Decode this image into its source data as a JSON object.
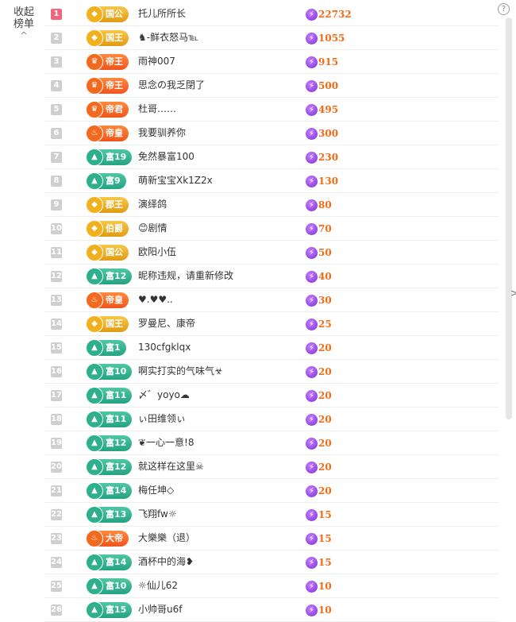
{
  "sidebar": {
    "collapse_label": "收起榜单",
    "collapse_icon": "chevron-up-icon",
    "chevron": "^"
  },
  "help_icon": "?",
  "side_arrow": ">",
  "rows": [
    {
      "rank": "1",
      "badge": "国公",
      "tier": "gold",
      "icon": "crown-icon",
      "glyph": "◆",
      "name": "托儿所所长",
      "score": "22732"
    },
    {
      "rank": "2",
      "badge": "国王",
      "tier": "gold",
      "icon": "crown-icon",
      "glyph": "◆",
      "name": "♞-鲜衣怒马℡",
      "score": "1055"
    },
    {
      "rank": "3",
      "badge": "帝王",
      "tier": "orange",
      "icon": "shield-icon",
      "glyph": "♛",
      "name": "雨神007",
      "score": "915"
    },
    {
      "rank": "4",
      "badge": "帝王",
      "tier": "orange",
      "icon": "shield-icon",
      "glyph": "♛",
      "name": "思念の我乏閉了",
      "score": "500"
    },
    {
      "rank": "5",
      "badge": "帝君",
      "tier": "orange",
      "icon": "shield-icon",
      "glyph": "♛",
      "name": "杜哥……",
      "score": "495"
    },
    {
      "rank": "6",
      "badge": "帝皇",
      "tier": "orange",
      "icon": "dragon-icon",
      "glyph": "♨",
      "name": "我要驯养你",
      "score": "300"
    },
    {
      "rank": "7",
      "badge": "富19",
      "tier": "teal",
      "icon": "mountain-icon",
      "glyph": "▲",
      "name": "免然暴富100",
      "score": "230"
    },
    {
      "rank": "8",
      "badge": "富9",
      "tier": "teal",
      "icon": "mountain-icon",
      "glyph": "▲",
      "name": "萌新宝宝Xk1Z2x",
      "score": "130"
    },
    {
      "rank": "9",
      "badge": "郡王",
      "tier": "gold",
      "icon": "crown-icon",
      "glyph": "◆",
      "name": "演绎鸽",
      "score": "80"
    },
    {
      "rank": "10",
      "badge": "伯爵",
      "tier": "gold",
      "icon": "crown-icon",
      "glyph": "◆",
      "name": "😊剧情",
      "score": "70"
    },
    {
      "rank": "11",
      "badge": "国公",
      "tier": "gold",
      "icon": "crown-icon",
      "glyph": "◆",
      "name": "欧阳小伍",
      "score": "50"
    },
    {
      "rank": "12",
      "badge": "富12",
      "tier": "teal",
      "icon": "mountain-icon",
      "glyph": "▲",
      "name": "昵称违规，请重新修改",
      "score": "40"
    },
    {
      "rank": "13",
      "badge": "帝皇",
      "tier": "orange",
      "icon": "dragon-icon",
      "glyph": "♨",
      "name": "♥.♥♥..",
      "score": "30"
    },
    {
      "rank": "14",
      "badge": "国王",
      "tier": "gold",
      "icon": "crown-icon",
      "glyph": "◆",
      "name": "罗曼尼、康帝",
      "score": "25"
    },
    {
      "rank": "15",
      "badge": "富1",
      "tier": "teal",
      "icon": "mountain-icon",
      "glyph": "▲",
      "name": "130cfgklqx",
      "score": "20"
    },
    {
      "rank": "16",
      "badge": "富10",
      "tier": "teal",
      "icon": "mountain-icon",
      "glyph": "▲",
      "name": "啊实打实的气味气☣",
      "score": "20"
    },
    {
      "rank": "17",
      "badge": "富11",
      "tier": "teal",
      "icon": "mountain-icon",
      "glyph": "▲",
      "name": "〆゛yoyo☁",
      "score": "20"
    },
    {
      "rank": "18",
      "badge": "富11",
      "tier": "teal",
      "icon": "mountain-icon",
      "glyph": "▲",
      "name": "ぃ田维领ぃ",
      "score": "20"
    },
    {
      "rank": "19",
      "badge": "富12",
      "tier": "teal",
      "icon": "mountain-icon",
      "glyph": "▲",
      "name": "❦一心一意!8",
      "score": "20"
    },
    {
      "rank": "20",
      "badge": "富12",
      "tier": "teal",
      "icon": "mountain-icon",
      "glyph": "▲",
      "name": "就这样在这里☠",
      "score": "20"
    },
    {
      "rank": "21",
      "badge": "富14",
      "tier": "teal",
      "icon": "mountain-icon",
      "glyph": "▲",
      "name": "梅任坤◇",
      "score": "20"
    },
    {
      "rank": "22",
      "badge": "富13",
      "tier": "teal",
      "icon": "mountain-icon",
      "glyph": "▲",
      "name": "飞翔fw☼",
      "score": "15"
    },
    {
      "rank": "23",
      "badge": "大帝",
      "tier": "orange",
      "icon": "dragon-icon",
      "glyph": "♨",
      "name": "大樂樂（退）",
      "score": "15"
    },
    {
      "rank": "24",
      "badge": "富14",
      "tier": "teal",
      "icon": "mountain-icon",
      "glyph": "▲",
      "name": "酒杯中的海❥",
      "score": "15"
    },
    {
      "rank": "25",
      "badge": "富10",
      "tier": "teal",
      "icon": "mountain-icon",
      "glyph": "▲",
      "name": "☼仙儿62",
      "score": "10"
    },
    {
      "rank": "26",
      "badge": "富15",
      "tier": "teal",
      "icon": "mountain-icon",
      "glyph": "▲",
      "name": "小帅哥u6f",
      "score": "10"
    }
  ],
  "score_icon": "lightning-icon",
  "score_glyph": "⚡",
  "colors": {
    "gold": "#e6a520",
    "orange": "#f36a1f",
    "teal": "#2eb08d",
    "score": "#f26a13",
    "top_rank": "#f0657c"
  }
}
